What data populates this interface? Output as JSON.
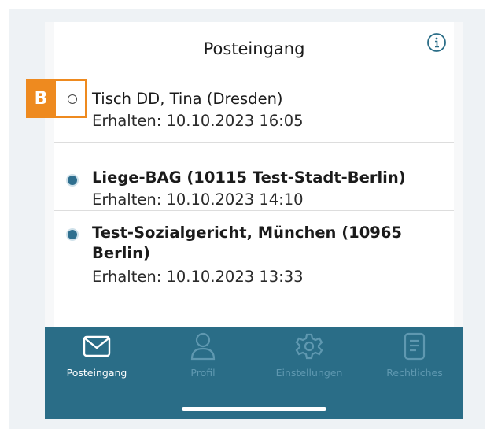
{
  "header": {
    "title": "Posteingang",
    "info_icon": "info-circle-icon"
  },
  "messages": [
    {
      "sender": "Tisch DD, Tina (Dresden)",
      "received": "Erhalten: 10.10.2023 16:05",
      "read": true
    },
    {
      "sender": "Liege-BAG (10115 Test-Stadt-Berlin)",
      "received": "Erhalten: 10.10.2023 14:10",
      "read": false
    },
    {
      "sender": "Test-Sozialgericht, München (10965 Berlin)",
      "received": "Erhalten: 10.10.2023 13:33",
      "read": false
    }
  ],
  "annotation": {
    "label": "B",
    "color": "#ee8a1f"
  },
  "tabs": [
    {
      "label": "Posteingang",
      "icon": "envelope-icon",
      "active": true
    },
    {
      "label": "Profil",
      "icon": "person-icon",
      "active": false
    },
    {
      "label": "Einstellungen",
      "icon": "gear-icon",
      "active": false
    },
    {
      "label": "Rechtliches",
      "icon": "document-icon",
      "active": false
    }
  ],
  "colors": {
    "tabbar": "#2a6d87",
    "active": "#ffffff",
    "inactive": "#5f98b0",
    "unread_dot": "#2f6f8f"
  }
}
